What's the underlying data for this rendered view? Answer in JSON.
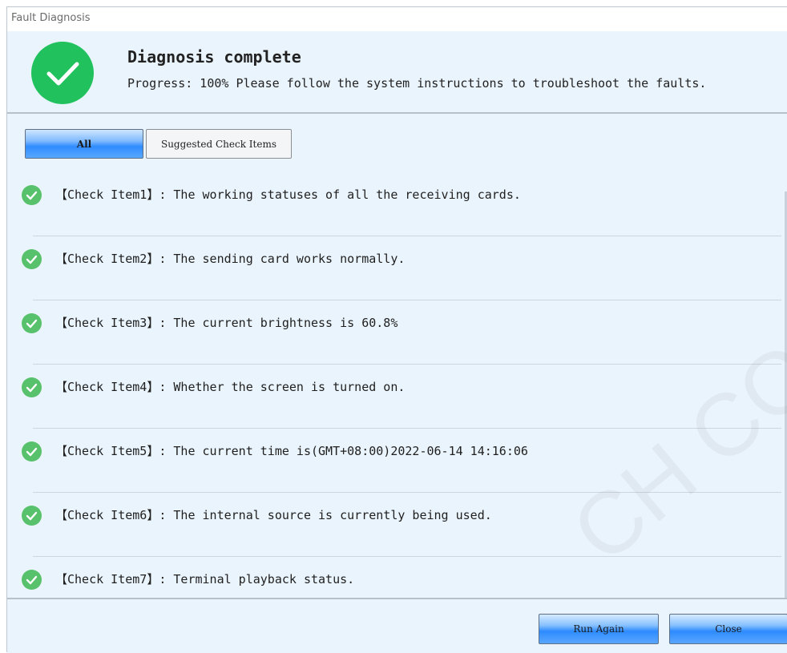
{
  "window": {
    "title": "Fault Diagnosis"
  },
  "header": {
    "title": "Diagnosis complete",
    "subtitle": "Progress: 100% Please follow the system instructions to troubleshoot the faults.",
    "status_icon": "check-circle-icon",
    "status_color": "#21c25e"
  },
  "tabs": [
    {
      "label": "All",
      "selected": true
    },
    {
      "label": "Suggested Check Items",
      "selected": false
    }
  ],
  "items": [
    {
      "label": "【Check Item1】: The working statuses of all the receiving cards.",
      "status": "pass"
    },
    {
      "label": "【Check Item2】: The sending card works normally.",
      "status": "pass"
    },
    {
      "label": "【Check Item3】: The current brightness is 60.8%",
      "status": "pass"
    },
    {
      "label": "【Check Item4】: Whether the screen is turned on.",
      "status": "pass"
    },
    {
      "label": "【Check Item5】: The current time is(GMT+08:00)2022-06-14 14:16:06",
      "status": "pass"
    },
    {
      "label": "【Check Item6】: The internal source is currently being used.",
      "status": "pass"
    },
    {
      "label": "【Check Item7】: Terminal playback status.",
      "status": "pass"
    }
  ],
  "footer": {
    "run_again_label": "Run Again",
    "close_label": "Close"
  },
  "colors": {
    "pass": "#57c16b",
    "accent": "#2f8cff",
    "background": "#eaf4fc"
  },
  "watermark_text": "CH CO."
}
